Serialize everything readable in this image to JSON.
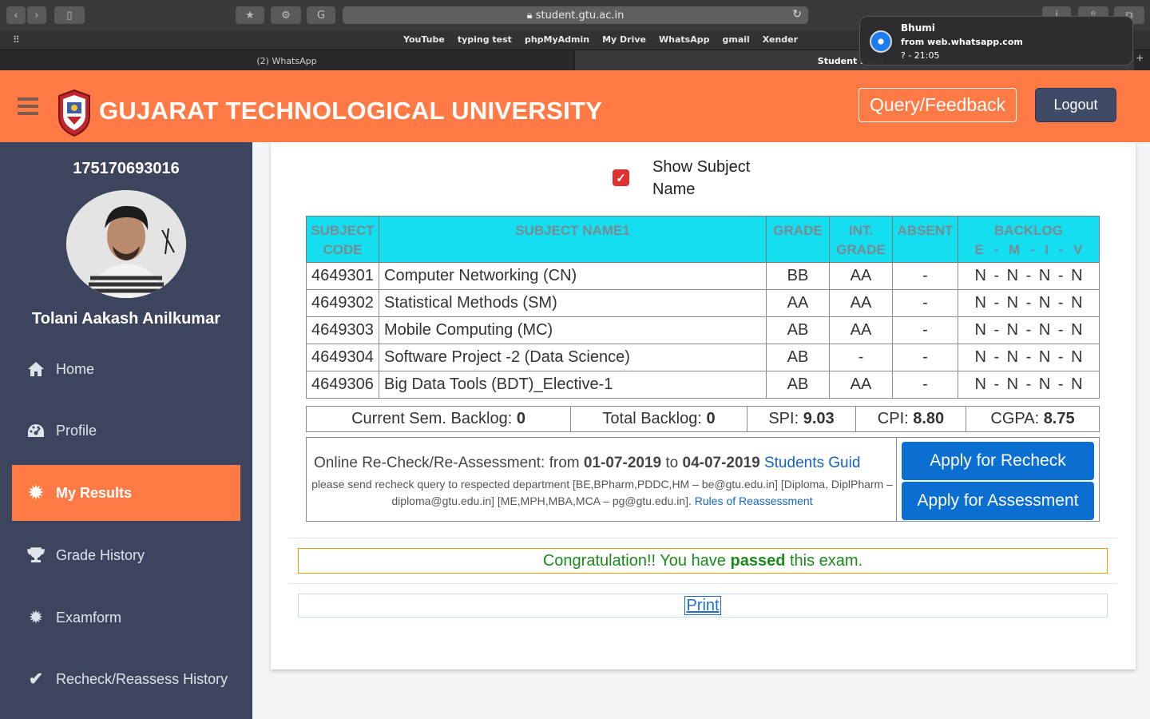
{
  "browser": {
    "url": "student.gtu.ac.in",
    "bookmarks": [
      "YouTube",
      "typing test",
      "phpMyAdmin",
      "My Drive",
      "WhatsApp",
      "gmail",
      "Xender"
    ],
    "tabs": [
      "(2) WhatsApp",
      "Student Profi"
    ]
  },
  "notification": {
    "title": "Bhumi",
    "subtitle": "from web.whatsapp.com",
    "body": "? - 21:05"
  },
  "header": {
    "title": "GUJARAT TECHNOLOGICAL UNIVERSITY",
    "query_label": "Query/Feedback",
    "logout_label": "Logout",
    "color": "#ff7a45"
  },
  "sidebar": {
    "enrollment": "175170693016",
    "student_name": "Tolani Aakash Anilkumar",
    "items": [
      {
        "label": "Home",
        "icon": "home-icon"
      },
      {
        "label": "Profile",
        "icon": "dashboard-icon"
      },
      {
        "label": "My Results",
        "icon": "gear-icon",
        "active": true
      },
      {
        "label": "Grade History",
        "icon": "trophy-icon"
      },
      {
        "label": "Examform",
        "icon": "gear-icon"
      },
      {
        "label": "Recheck/Reassess History",
        "icon": "check-icon"
      }
    ]
  },
  "results": {
    "show_subject_label": "Show Subject Name",
    "show_subject_checked": true,
    "headers": {
      "code": "SUBJECT CODE",
      "name": "SUBJECT NAME1",
      "grade": "GRADE",
      "int_grade": "INT. GRADE",
      "absent": "ABSENT",
      "backlog": "BACKLOG",
      "backlog_sub": "E - M - I - V"
    },
    "rows": [
      {
        "code": "4649301",
        "name": "Computer Networking (CN)",
        "grade": "BB",
        "int_grade": "AA",
        "absent": "-",
        "backlog": "N - N - N - N"
      },
      {
        "code": "4649302",
        "name": "Statistical Methods (SM)",
        "grade": "AA",
        "int_grade": "AA",
        "absent": "-",
        "backlog": "N - N - N - N"
      },
      {
        "code": "4649303",
        "name": "Mobile Computing (MC)",
        "grade": "AB",
        "int_grade": "AA",
        "absent": "-",
        "backlog": "N - N - N - N"
      },
      {
        "code": "4649304",
        "name": "Software Project -2 (Data Science)",
        "grade": "AB",
        "int_grade": "-",
        "absent": "-",
        "backlog": "N - N - N - N"
      },
      {
        "code": "4649306",
        "name": "Big Data Tools (BDT)_Elective-1",
        "grade": "AB",
        "int_grade": "AA",
        "absent": "-",
        "backlog": "N - N - N - N"
      }
    ],
    "summary": {
      "current_backlog_label": "Current Sem. Backlog: ",
      "current_backlog": "0",
      "total_backlog_label": "Total Backlog: ",
      "total_backlog": "0",
      "spi_label": "SPI: ",
      "spi": "9.03",
      "cpi_label": "CPI: ",
      "cpi": "8.80",
      "cgpa_label": "CGPA: ",
      "cgpa": "8.75"
    }
  },
  "recheck": {
    "intro": "Online Re-Check/Re-Assessment: from ",
    "from": "01-07-2019",
    "to_word": " to ",
    "to": "04-07-2019",
    "guide_link": "Students Guid",
    "note": "please send recheck query to respected department [BE,BPharm,PDDC,HM – be@gtu.edu.in] [Diploma, DiplPharm – diploma@gtu.edu.in] [ME,MPH,MBA,MCA – pg@gtu.edu.in]. ",
    "rules_link": "Rules of Reassessment",
    "recheck_button": "Apply for Recheck",
    "assessment_button": "Apply for Assessment"
  },
  "status": {
    "prefix": "Congratulation!! You have ",
    "bold": "passed",
    "suffix": " this exam."
  },
  "print_label": "Print"
}
